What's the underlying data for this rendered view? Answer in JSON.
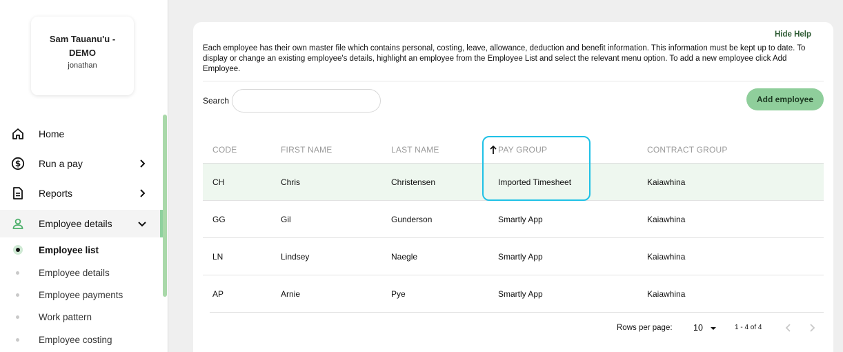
{
  "user": {
    "name": "Sam Tauanu'u - DEMO",
    "login": "jonathan"
  },
  "nav": {
    "home": "Home",
    "run_a_pay": "Run a pay",
    "reports": "Reports",
    "employee_details": "Employee details"
  },
  "subnav": [
    "Employee list",
    "Employee details",
    "Employee payments",
    "Work pattern",
    "Employee costing"
  ],
  "help": {
    "hide_label": "Hide Help",
    "text": "Each employee has their own master file which contains personal, costing, leave, allowance, deduction and benefit information. This information must be kept up to date. To display or change an existing employee's details, highlight an employee from the Employee List and select the relevant menu option. To add a new employee click Add Employee."
  },
  "search": {
    "label": "Search",
    "value": ""
  },
  "add_employee_label": "Add employee",
  "table": {
    "headers": [
      "CODE",
      "FIRST NAME",
      "LAST NAME",
      "PAY GROUP",
      "CONTRACT GROUP"
    ],
    "rows": [
      [
        "CH",
        "Chris",
        "Christensen",
        "Imported Timesheet",
        "Kaiawhina"
      ],
      [
        "GG",
        "Gil",
        "Gunderson",
        "Smartly App",
        "Kaiawhina"
      ],
      [
        "LN",
        "Lindsey",
        "Naegle",
        "Smartly App",
        "Kaiawhina"
      ],
      [
        "AP",
        "Arnie",
        "Pye",
        "Smartly App",
        "Kaiawhina"
      ]
    ]
  },
  "pagination": {
    "rows_per_page_label": "Rows per page:",
    "rows_per_page": "10",
    "range": "1 - 4 of 4"
  },
  "colors": {
    "accent_green": "#8fce9b",
    "highlight_cyan": "#1fc1e6",
    "selected_row": "#eef7ef"
  }
}
